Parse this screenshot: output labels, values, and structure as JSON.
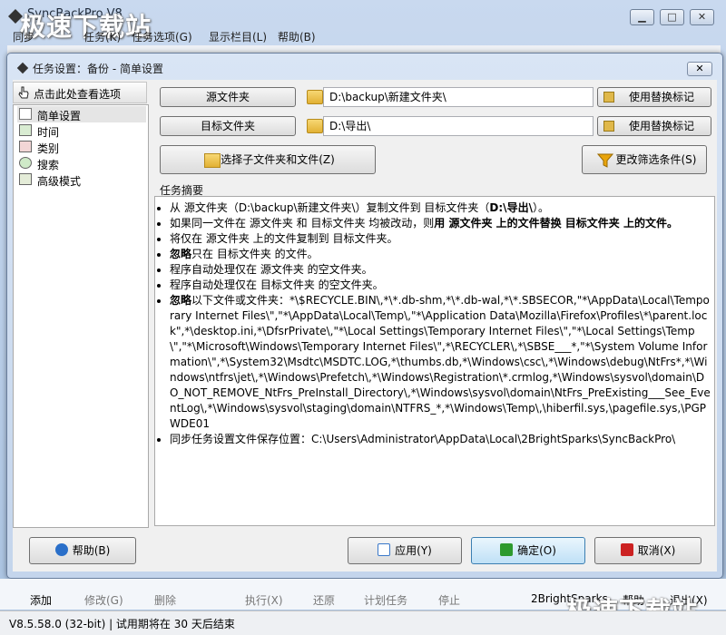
{
  "app": {
    "title": "SyncBackPro V8",
    "watermark": "极速下载站",
    "menu": [
      "同步",
      "任务(K)",
      "任务选项(G)",
      "显示栏目(L)",
      "帮助(B)"
    ],
    "window_buttons": [
      "minimize",
      "maximize",
      "close"
    ]
  },
  "dialog": {
    "title": "任务设置：备份 - 简单设置",
    "nav_header": "点击此处查看选项",
    "nav_items": [
      {
        "label": "简单设置",
        "icon": "checklist-icon",
        "selected": true
      },
      {
        "label": "时间",
        "icon": "clock-icon",
        "selected": false
      },
      {
        "label": "类别",
        "icon": "category-icon",
        "selected": false
      },
      {
        "label": "搜索",
        "icon": "search-icon",
        "selected": false
      },
      {
        "label": "高级模式",
        "icon": "grid-icon",
        "selected": false
      }
    ],
    "source": {
      "button": "源文件夹",
      "path": "D:\\backup\\新建文件夹\\",
      "replace": "使用替换标记"
    },
    "target": {
      "button": "目标文件夹",
      "path": "D:\\导出\\",
      "replace": "使用替换标记"
    },
    "select_sub": "选择子文件夹和文件(Z)",
    "change_filter": "更改筛选条件(S)",
    "summary_label": "任务摘要",
    "summary": {
      "l1": "从 源文件夹（D:\\backup\\新建文件夹\\）复制文件到 目标文件夹（",
      "l1b": "D:\\导出\\",
      "l1c": "）。",
      "l2": "如果同一文件在 源文件夹 和 目标文件夹 均被改动，则",
      "l2b": "用 源文件夹 上的文件替换 目标文件夹 上的文件。",
      "l3": "将仅在 源文件夹 上的文件复制到 目标文件夹。",
      "l4b": "忽略",
      "l4": "只在 目标文件夹 的文件。",
      "l5": "程序自动处理仅在 源文件夹 的空文件夹。",
      "l6": "程序自动处理仅在 目标文件夹 的空文件夹。",
      "l7b": "忽略",
      "l7": "以下文件或文件夹：*\\$RECYCLE.BIN\\,*\\*.db-shm,*\\*.db-wal,*\\*.SBSECOR,\"*\\AppData\\Local\\Temporary Internet Files\\\",\"*\\AppData\\Local\\Temp\\,\"*\\Application Data\\Mozilla\\Firefox\\Profiles\\*\\parent.lock\",*\\desktop.ini,*\\DfsrPrivate\\,\"*\\Local Settings\\Temporary Internet Files\\\",\"*\\Local Settings\\Temp\\\",\"*\\Microsoft\\Windows\\Temporary Internet Files\\\",*\\RECYCLER\\,*\\SBSE___*,\"*\\System Volume Information\\\",*\\System32\\Msdtc\\MSDTC.LOG,*\\thumbs.db,*\\Windows\\csc\\,*\\Windows\\debug\\NtFrs*,*\\Windows\\ntfrs\\jet\\,*\\Windows\\Prefetch\\,*\\Windows\\Registration\\*.crmlog,*\\Windows\\sysvol\\domain\\DO_NOT_REMOVE_NtFrs_PreInstall_Directory\\,*\\Windows\\sysvol\\domain\\NtFrs_PreExisting___See_EventLog\\,*\\Windows\\sysvol\\staging\\domain\\NTFRS_*,*\\Windows\\Temp\\,\\hiberfil.sys,\\pagefile.sys,\\PGPWDE01",
      "l8": "同步任务设置文件保存位置：C:\\Users\\Administrator\\AppData\\Local\\2BrightSparks\\SyncBackPro\\"
    },
    "buttons": {
      "help": "帮助(B)",
      "apply": "应用(Y)",
      "ok": "确定(O)",
      "cancel": "取消(X)"
    }
  },
  "toolbar": [
    "添加",
    "修改(G)",
    "删除",
    "执行(X)",
    "还原",
    "计划任务",
    "停止",
    "2BrightSparks",
    "帮助",
    "退出(X)"
  ],
  "status": "V8.5.58.0 (32-bit) | 试用期将在 30 天后结束",
  "colors": {
    "ok_check": "#2e9a2e",
    "cancel_x": "#cc2222",
    "help_circle": "#2a6fc9",
    "filter_funnel": "#e8a40c"
  }
}
